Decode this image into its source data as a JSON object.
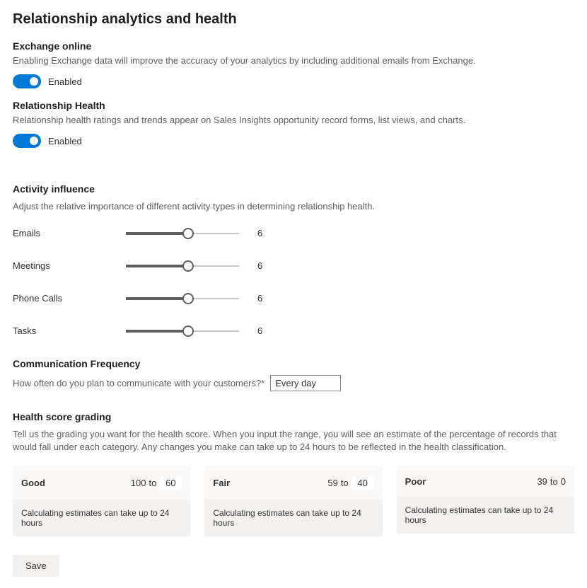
{
  "page_title": "Relationship analytics and health",
  "exchange": {
    "title": "Exchange online",
    "desc": "Enabling Exchange data will improve the accuracy of your analytics by including additional emails from Exchange.",
    "toggle_label": "Enabled"
  },
  "rel_health": {
    "title": "Relationship Health",
    "desc": "Relationship health ratings and trends appear on Sales Insights opportunity record forms, list views, and charts.",
    "toggle_label": "Enabled"
  },
  "activity": {
    "title": "Activity influence",
    "desc": "Adjust the relative importance of different activity types in determining relationship health.",
    "sliders": [
      {
        "label": "Emails",
        "value": "6"
      },
      {
        "label": "Meetings",
        "value": "6"
      },
      {
        "label": "Phone Calls",
        "value": "6"
      },
      {
        "label": "Tasks",
        "value": "6"
      }
    ]
  },
  "freq": {
    "title": "Communication Frequency",
    "label": "How often do you plan to communicate with your customers?*",
    "value": "Every day"
  },
  "grading": {
    "title": "Health score grading",
    "desc": "Tell us the grading you want for the health score. When you input the range, you will see an estimate of the percentage of records that would fall under each category. Any changes you make can take up to 24 hours to be reflected in the health classification.",
    "note": "Calculating estimates can take up to 24 hours",
    "to_label": "to",
    "cards": [
      {
        "name": "Good",
        "high": "100",
        "low": "60",
        "editable": true
      },
      {
        "name": "Fair",
        "high": "59",
        "low": "40",
        "editable": true
      },
      {
        "name": "Poor",
        "high": "39",
        "low": "0",
        "editable": false
      }
    ]
  },
  "save_label": "Save"
}
